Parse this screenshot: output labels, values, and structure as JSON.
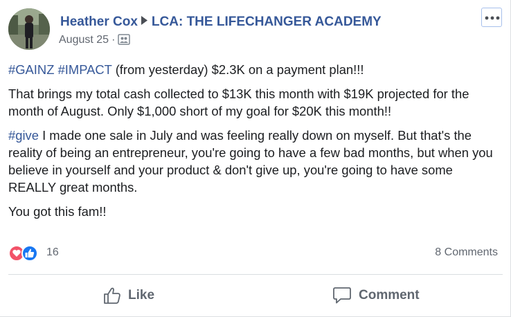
{
  "post": {
    "author": "Heather Cox",
    "group": "LCA: THE LIFECHANGER ACADEMY",
    "date": "August 25",
    "separator": "·",
    "icons": {
      "more": "more-options-icon",
      "audience": "group-audience-icon",
      "arrow": "right-triangle-icon"
    },
    "paragraphs": [
      {
        "hashtags": [
          "#GAINZ",
          "#IMPACT"
        ],
        "text": " (from yesterday) $2.3K on a payment plan!!!"
      },
      {
        "text": "That brings my total cash collected to $13K this month with $19K projected for the month of August. Only $1,000 short of my goal for $20K this month!!"
      },
      {
        "hashtag": "#give",
        "text": " I made one sale in July and was feeling really down on myself. But that's the reality of being an entrepreneur, you're going to have a few bad months, but when you believe in yourself and your product & don't give up, you're going to have some REALLY great months."
      },
      {
        "text": "You got this fam!!"
      }
    ]
  },
  "reactions": {
    "types": [
      "love",
      "like"
    ],
    "count": "16",
    "comments": "8 Comments",
    "colors": {
      "love": "#f25268",
      "like": "#1877f2"
    }
  },
  "actions": {
    "like_label": "Like",
    "comment_label": "Comment"
  },
  "colors": {
    "link": "#365899",
    "secondary": "#616770",
    "action": "#606770"
  }
}
